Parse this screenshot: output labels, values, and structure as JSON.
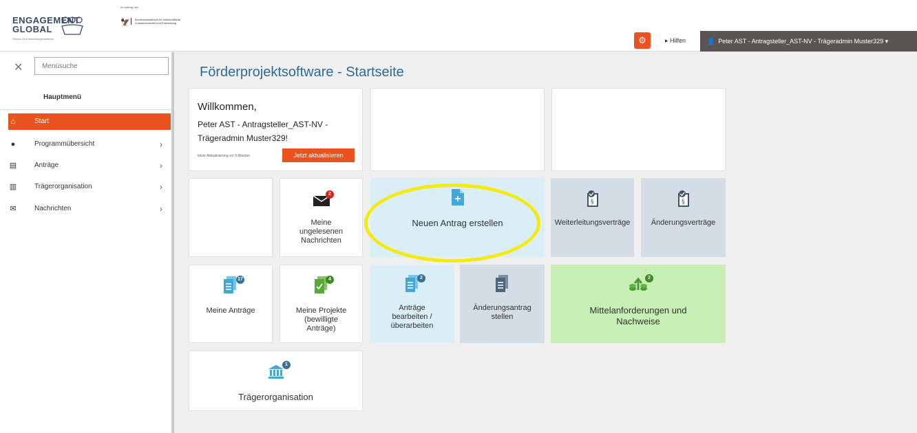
{
  "header": {
    "logo_line1": "ENGAGEMENT",
    "logo_line2": "GLOBAL",
    "logo_sub": "Service für Entwicklungsinitiativen",
    "bmz_auftrag": "Im Auftrag des",
    "bmz_ministry": "Bundesministerium für wirtschaftliche Zusammenarbeit und Entwicklung",
    "help_label": "Hilfen",
    "user_label": "Peter AST - Antragsteller_AST-NV - Trägeradmin Muster329"
  },
  "sidebar": {
    "search_placeholder": "Menüsuche",
    "title": "Hauptmenü",
    "items": [
      {
        "label": "Start",
        "icon": "home-icon"
      },
      {
        "label": "Programmübersicht",
        "icon": "globe-icon"
      },
      {
        "label": "Anträge",
        "icon": "documents-icon"
      },
      {
        "label": "Trägerorganisation",
        "icon": "institution-icon"
      },
      {
        "label": "Nachrichten",
        "icon": "envelope-icon"
      }
    ]
  },
  "main": {
    "title": "Förderprojektsoftware - Startseite",
    "welcome": {
      "greeting": "Willkommen,",
      "name": "Peter AST - Antragsteller_AST-NV - Trägeradmin Muster329!",
      "last_update": "letzte Aktualisierung vor 9 Minuten",
      "refresh_label": "Jetzt aktualisieren"
    },
    "tiles": {
      "messages": {
        "label": "Meine ungelesenen Nachrichten",
        "badge": "2"
      },
      "new_application": {
        "label": "Neuen Antrag erstellen"
      },
      "forwarding": {
        "label": "Weiterleitungsverträge"
      },
      "amendment_contracts": {
        "label": "Änderungsverträge"
      },
      "my_applications": {
        "label": "Meine Anträge",
        "badge": "17"
      },
      "my_projects": {
        "label": "Meine Projekte (bewilligte Anträge)",
        "badge": "4"
      },
      "edit_applications": {
        "label": "Anträge bearbeiten / überarbeiten",
        "badge": "2"
      },
      "change_request": {
        "label": "Änderungsantrag stellen"
      },
      "funds": {
        "label": "Mittelanforderungen und Nachweise",
        "badge": "2"
      },
      "organisation": {
        "label": "Trägerorganisation",
        "badge": "1"
      }
    }
  },
  "colors": {
    "accent": "#e8531f",
    "title_blue": "#2e6a99",
    "highlight": "#f4ea0e",
    "tile_blue": "#d9eef7",
    "tile_grey": "#d4dce6",
    "tile_green": "#c7eeb5"
  }
}
